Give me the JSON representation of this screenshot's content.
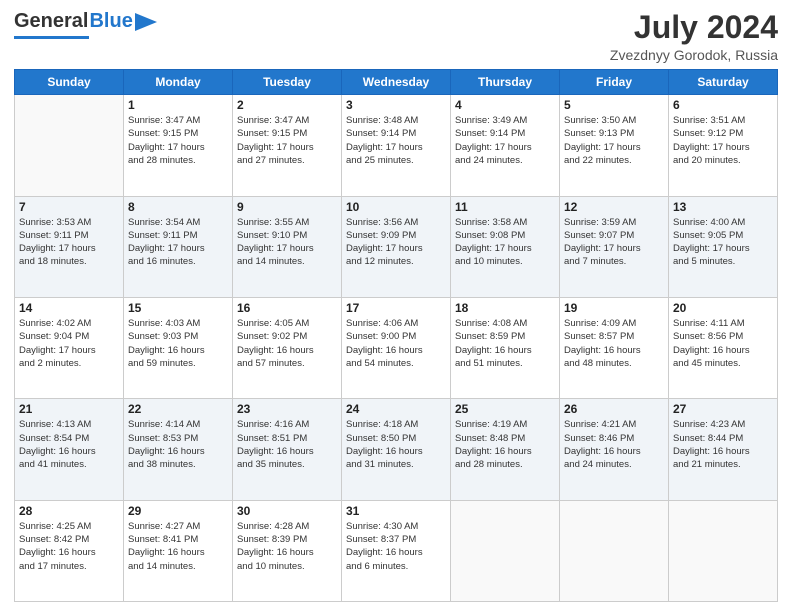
{
  "header": {
    "logo_general": "General",
    "logo_blue": "Blue",
    "title": "July 2024",
    "location": "Zvezdnyy Gorodok, Russia"
  },
  "days_of_week": [
    "Sunday",
    "Monday",
    "Tuesday",
    "Wednesday",
    "Thursday",
    "Friday",
    "Saturday"
  ],
  "weeks": [
    [
      {
        "num": "",
        "info": ""
      },
      {
        "num": "1",
        "info": "Sunrise: 3:47 AM\nSunset: 9:15 PM\nDaylight: 17 hours\nand 28 minutes."
      },
      {
        "num": "2",
        "info": "Sunrise: 3:47 AM\nSunset: 9:15 PM\nDaylight: 17 hours\nand 27 minutes."
      },
      {
        "num": "3",
        "info": "Sunrise: 3:48 AM\nSunset: 9:14 PM\nDaylight: 17 hours\nand 25 minutes."
      },
      {
        "num": "4",
        "info": "Sunrise: 3:49 AM\nSunset: 9:14 PM\nDaylight: 17 hours\nand 24 minutes."
      },
      {
        "num": "5",
        "info": "Sunrise: 3:50 AM\nSunset: 9:13 PM\nDaylight: 17 hours\nand 22 minutes."
      },
      {
        "num": "6",
        "info": "Sunrise: 3:51 AM\nSunset: 9:12 PM\nDaylight: 17 hours\nand 20 minutes."
      }
    ],
    [
      {
        "num": "7",
        "info": "Sunrise: 3:53 AM\nSunset: 9:11 PM\nDaylight: 17 hours\nand 18 minutes."
      },
      {
        "num": "8",
        "info": "Sunrise: 3:54 AM\nSunset: 9:11 PM\nDaylight: 17 hours\nand 16 minutes."
      },
      {
        "num": "9",
        "info": "Sunrise: 3:55 AM\nSunset: 9:10 PM\nDaylight: 17 hours\nand 14 minutes."
      },
      {
        "num": "10",
        "info": "Sunrise: 3:56 AM\nSunset: 9:09 PM\nDaylight: 17 hours\nand 12 minutes."
      },
      {
        "num": "11",
        "info": "Sunrise: 3:58 AM\nSunset: 9:08 PM\nDaylight: 17 hours\nand 10 minutes."
      },
      {
        "num": "12",
        "info": "Sunrise: 3:59 AM\nSunset: 9:07 PM\nDaylight: 17 hours\nand 7 minutes."
      },
      {
        "num": "13",
        "info": "Sunrise: 4:00 AM\nSunset: 9:05 PM\nDaylight: 17 hours\nand 5 minutes."
      }
    ],
    [
      {
        "num": "14",
        "info": "Sunrise: 4:02 AM\nSunset: 9:04 PM\nDaylight: 17 hours\nand 2 minutes."
      },
      {
        "num": "15",
        "info": "Sunrise: 4:03 AM\nSunset: 9:03 PM\nDaylight: 16 hours\nand 59 minutes."
      },
      {
        "num": "16",
        "info": "Sunrise: 4:05 AM\nSunset: 9:02 PM\nDaylight: 16 hours\nand 57 minutes."
      },
      {
        "num": "17",
        "info": "Sunrise: 4:06 AM\nSunset: 9:00 PM\nDaylight: 16 hours\nand 54 minutes."
      },
      {
        "num": "18",
        "info": "Sunrise: 4:08 AM\nSunset: 8:59 PM\nDaylight: 16 hours\nand 51 minutes."
      },
      {
        "num": "19",
        "info": "Sunrise: 4:09 AM\nSunset: 8:57 PM\nDaylight: 16 hours\nand 48 minutes."
      },
      {
        "num": "20",
        "info": "Sunrise: 4:11 AM\nSunset: 8:56 PM\nDaylight: 16 hours\nand 45 minutes."
      }
    ],
    [
      {
        "num": "21",
        "info": "Sunrise: 4:13 AM\nSunset: 8:54 PM\nDaylight: 16 hours\nand 41 minutes."
      },
      {
        "num": "22",
        "info": "Sunrise: 4:14 AM\nSunset: 8:53 PM\nDaylight: 16 hours\nand 38 minutes."
      },
      {
        "num": "23",
        "info": "Sunrise: 4:16 AM\nSunset: 8:51 PM\nDaylight: 16 hours\nand 35 minutes."
      },
      {
        "num": "24",
        "info": "Sunrise: 4:18 AM\nSunset: 8:50 PM\nDaylight: 16 hours\nand 31 minutes."
      },
      {
        "num": "25",
        "info": "Sunrise: 4:19 AM\nSunset: 8:48 PM\nDaylight: 16 hours\nand 28 minutes."
      },
      {
        "num": "26",
        "info": "Sunrise: 4:21 AM\nSunset: 8:46 PM\nDaylight: 16 hours\nand 24 minutes."
      },
      {
        "num": "27",
        "info": "Sunrise: 4:23 AM\nSunset: 8:44 PM\nDaylight: 16 hours\nand 21 minutes."
      }
    ],
    [
      {
        "num": "28",
        "info": "Sunrise: 4:25 AM\nSunset: 8:42 PM\nDaylight: 16 hours\nand 17 minutes."
      },
      {
        "num": "29",
        "info": "Sunrise: 4:27 AM\nSunset: 8:41 PM\nDaylight: 16 hours\nand 14 minutes."
      },
      {
        "num": "30",
        "info": "Sunrise: 4:28 AM\nSunset: 8:39 PM\nDaylight: 16 hours\nand 10 minutes."
      },
      {
        "num": "31",
        "info": "Sunrise: 4:30 AM\nSunset: 8:37 PM\nDaylight: 16 hours\nand 6 minutes."
      },
      {
        "num": "",
        "info": ""
      },
      {
        "num": "",
        "info": ""
      },
      {
        "num": "",
        "info": ""
      }
    ]
  ]
}
